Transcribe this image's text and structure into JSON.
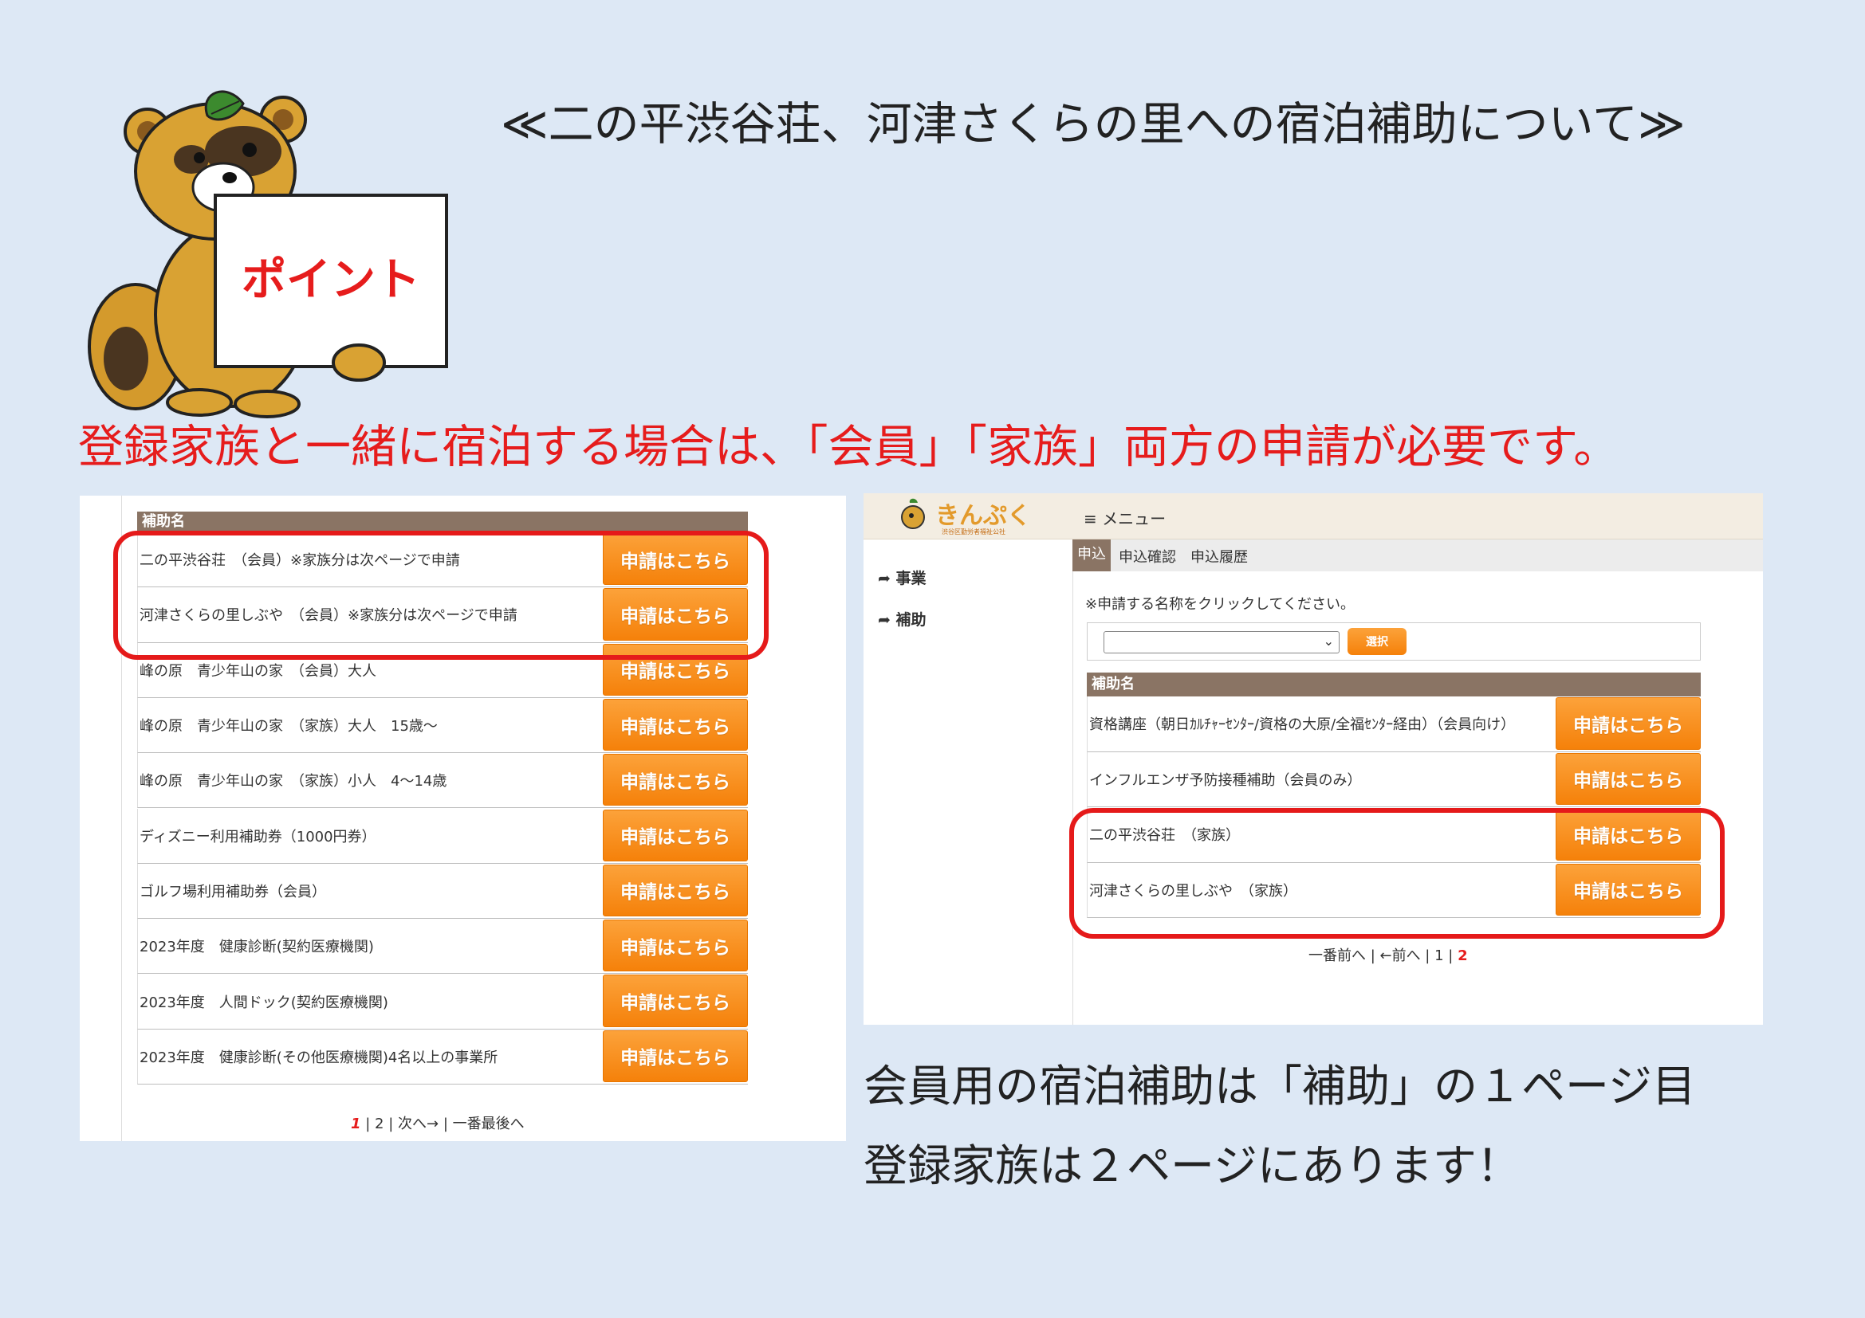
{
  "title": "≪二の平渋谷荘、河津さくらの里への宿泊補助について≫",
  "mascot": {
    "sign_text": "ポイント"
  },
  "notice": "登録家族と一緒に宿泊する場合は、「会員」「家族」両方の申請が必要です。",
  "note_lines": [
    "会員用の宿泊補助は「補助」の１ページ目",
    "登録家族は２ページにあります！"
  ],
  "left_screen": {
    "table_header": "補助名",
    "button_label": "申請はこちら",
    "rows": [
      "二の平渋谷荘　（会員）※家族分は次ページで申請",
      "河津さくらの里しぶや　（会員）※家族分は次ページで申請",
      "峰の原　青少年山の家　（会員）大人",
      "峰の原　青少年山の家　（家族）大人　15歳～",
      "峰の原　青少年山の家　（家族）小人　4～14歳",
      "ディズニー利用補助券（1000円券）",
      "ゴルフ場利用補助券（会員）",
      "2023年度　健康診断(契約医療機関)",
      "2023年度　人間ドック(契約医療機関)",
      "2023年度　健康診断(その他医療機関)4名以上の事業所"
    ],
    "pager": {
      "current": "1",
      "rest": "| 2 | 次へ→ | 一番最後へ"
    }
  },
  "right_screen": {
    "logo_text": "きんぷく",
    "logo_sub": "渋谷区勤労者福祉公社",
    "menu_label": "≡ メニュー",
    "sidebar": [
      "事業",
      "補助"
    ],
    "tabs": [
      "申込",
      "申込確認",
      "申込履歴"
    ],
    "instruction": "※申請する名称をクリックしてください。",
    "select_value": "",
    "select_button": "選択",
    "table_header": "補助名",
    "button_label": "申請はこちら",
    "rows": [
      "資格講座（朝日ｶﾙﾁｬｰｾﾝﾀｰ/資格の大原/全福ｾﾝﾀｰ経由）（会員向け）",
      "インフルエンザ予防接種補助（会員のみ）",
      "二の平渋谷荘　（家族）",
      "河津さくらの里しぶや　（家族）"
    ],
    "pager": {
      "rest": "一番前へ | ←前へ | 1 |",
      "current": "2"
    }
  },
  "colors": {
    "background": "#dde8f5",
    "highlight": "#e51a1a",
    "button": "#f5810a",
    "table_header": "#8a7464"
  }
}
